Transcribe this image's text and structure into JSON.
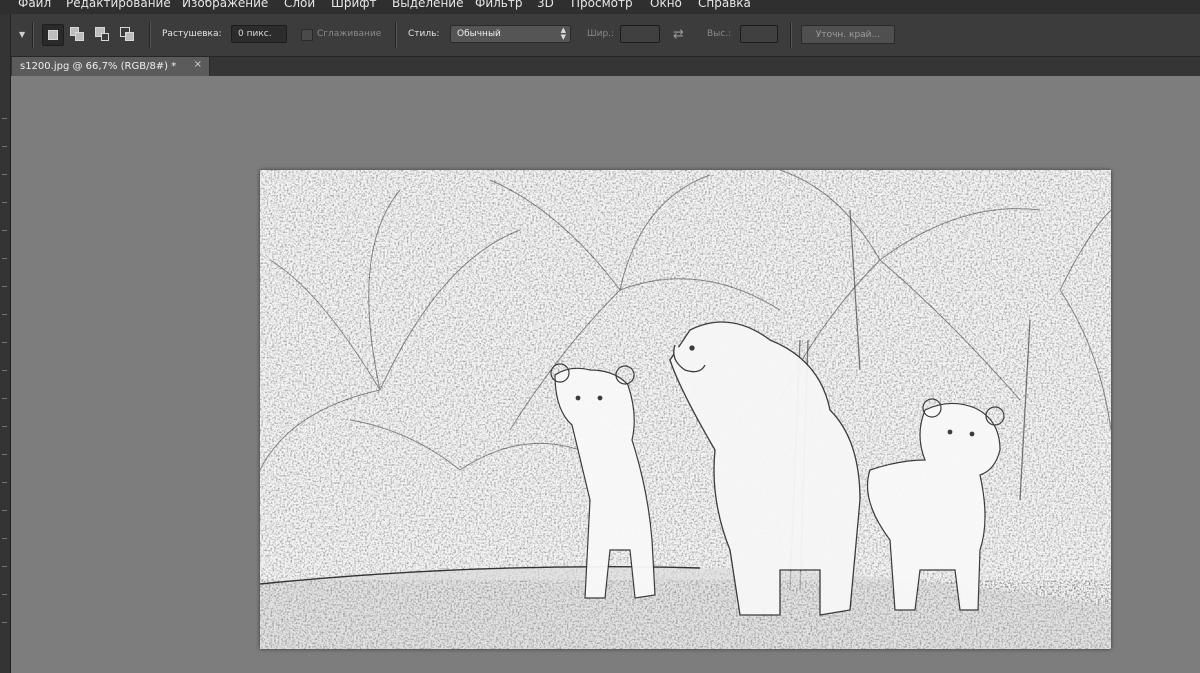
{
  "menu": {
    "items": [
      "Файл",
      "Редактирование",
      "Изображение",
      "Слои",
      "Шрифт",
      "Выделение",
      "Фильтр",
      "3D",
      "Просмотр",
      "Окно",
      "Справка"
    ]
  },
  "options": {
    "feather_label": "Растушевка:",
    "feather_value": "0 пикс.",
    "antialias_label": "Сглаживание",
    "style_label": "Стиль:",
    "style_value": "Обычный",
    "width_label": "Шир.:",
    "height_label": "Выс.:",
    "refine_edge_label": "Уточн. край..."
  },
  "document": {
    "tab_title": "s1200.jpg @ 66,7% (RGB/8#) *",
    "close_symbol": "×"
  },
  "icons": {
    "marquee": "rectangular-marquee-icon",
    "new_selection": "new-selection-icon",
    "add_selection": "add-to-selection-icon",
    "subtract_selection": "subtract-from-selection-icon",
    "intersect_selection": "intersect-selection-icon",
    "swap": "swap-arrows-icon"
  },
  "colors": {
    "menubar_bg": "#2f2f2f",
    "optbar_bg": "#3c3c3c",
    "workspace_bg": "#7d7d7d",
    "tab_active_bg": "#5b5b5b"
  }
}
